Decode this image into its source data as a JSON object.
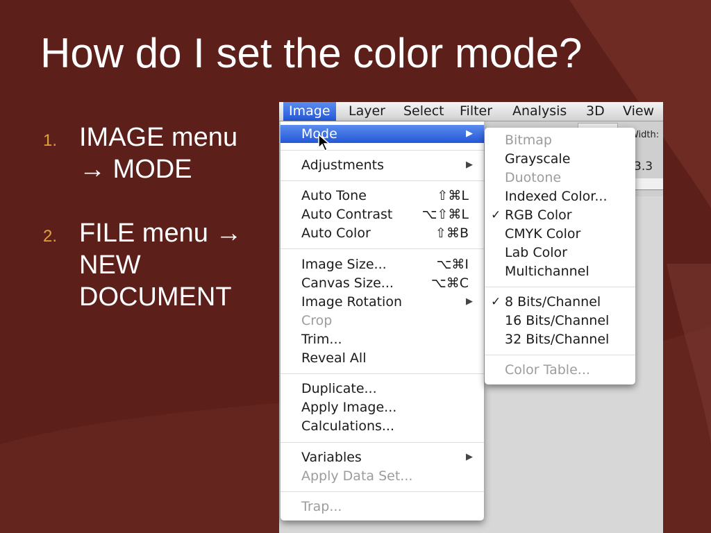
{
  "slide": {
    "title": "How do I set the color mode?",
    "bullets": [
      {
        "num": "1.",
        "text": "IMAGE menu → MODE"
      },
      {
        "num": "2.",
        "text": "FILE menu → NEW DOCUMENT"
      }
    ]
  },
  "menubar": [
    "Image",
    "Layer",
    "Select",
    "Filter",
    "Analysis",
    "3D",
    "View"
  ],
  "toolbar": {
    "width_label": "Width:",
    "value": "3.3"
  },
  "image_menu": [
    {
      "label": "Mode",
      "arrow": "▶"
    },
    {
      "label": "Adjustments",
      "arrow": "▶"
    },
    {
      "label": "Auto Tone",
      "shortcut": "⇧⌘L"
    },
    {
      "label": "Auto Contrast",
      "shortcut": "⌥⇧⌘L"
    },
    {
      "label": "Auto Color",
      "shortcut": "⇧⌘B"
    },
    {
      "label": "Image Size...",
      "shortcut": "⌥⌘I"
    },
    {
      "label": "Canvas Size...",
      "shortcut": "⌥⌘C"
    },
    {
      "label": "Image Rotation",
      "arrow": "▶"
    },
    {
      "label": "Crop"
    },
    {
      "label": "Trim..."
    },
    {
      "label": "Reveal All"
    },
    {
      "label": "Duplicate..."
    },
    {
      "label": "Apply Image..."
    },
    {
      "label": "Calculations..."
    },
    {
      "label": "Variables",
      "arrow": "▶"
    },
    {
      "label": "Apply Data Set..."
    },
    {
      "label": "Trap..."
    }
  ],
  "mode_submenu": [
    {
      "label": "Bitmap"
    },
    {
      "label": "Grayscale"
    },
    {
      "label": "Duotone"
    },
    {
      "label": "Indexed Color..."
    },
    {
      "label": "RGB Color",
      "check": "✓"
    },
    {
      "label": "CMYK Color"
    },
    {
      "label": "Lab Color"
    },
    {
      "label": "Multichannel"
    },
    {
      "label": "8 Bits/Channel",
      "check": "✓"
    },
    {
      "label": "16 Bits/Channel"
    },
    {
      "label": "32 Bits/Channel"
    },
    {
      "label": "Color Table..."
    }
  ],
  "icons": {
    "cursor": "arrow-cursor-icon",
    "submenu": "submenu-arrow-icon",
    "check": "checkmark-icon"
  },
  "colors": {
    "slide_bg": "#5c1f1a",
    "bullet_number": "#e0a23a",
    "menu_highlight": "#2f63dc"
  }
}
